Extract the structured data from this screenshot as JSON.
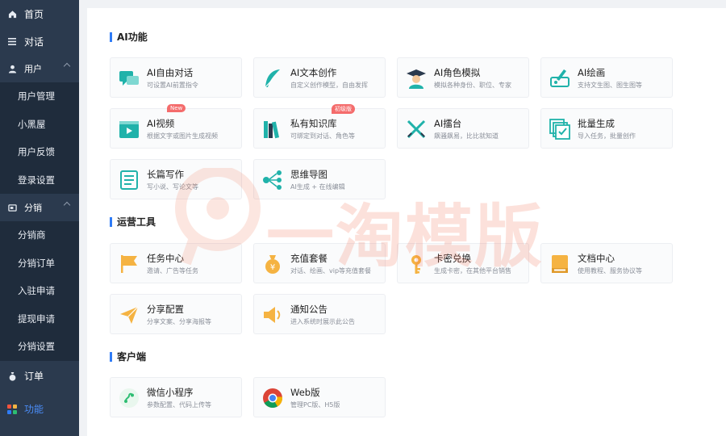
{
  "sidebar": {
    "home": "首页",
    "chat": "对话",
    "groups": [
      {
        "label": "用户",
        "items": [
          "用户管理",
          "小黑屋",
          "用户反馈",
          "登录设置"
        ]
      },
      {
        "label": "分销",
        "items": [
          "分销商",
          "分销订单",
          "入驻申请",
          "提现申请",
          "分销设置"
        ]
      }
    ],
    "order": "订单",
    "features": "功能"
  },
  "sections": {
    "ai": "AI功能",
    "ops": "运营工具",
    "client": "客户端"
  },
  "ai_cards": [
    {
      "title": "AI自由对话",
      "desc": "可设置AI前置指令"
    },
    {
      "title": "AI文本创作",
      "desc": "自定义创作模型，自由发挥"
    },
    {
      "title": "AI角色模拟",
      "desc": "模拟各种身份、职位、专家"
    },
    {
      "title": "AI绘画",
      "desc": "支持文生图、图生图等"
    },
    {
      "title": "AI视频",
      "desc": "根据文字或图片生成视频",
      "tag": "New"
    },
    {
      "title": "私有知识库",
      "desc": "可绑定到对话、角色等",
      "tag": "初级版"
    },
    {
      "title": "AI擂台",
      "desc": "飙骚飙易，比比就知道"
    },
    {
      "title": "批量生成",
      "desc": "导入任务，批量创作"
    },
    {
      "title": "长篇写作",
      "desc": "写小说、写论文等"
    },
    {
      "title": "思维导图",
      "desc": "AI生成 + 在线编辑"
    }
  ],
  "ops_cards": [
    {
      "title": "任务中心",
      "desc": "邀请、广告等任务"
    },
    {
      "title": "充值套餐",
      "desc": "对话、绘画、vip等充值套餐"
    },
    {
      "title": "卡密兑换",
      "desc": "生成卡密，在其他平台销售"
    },
    {
      "title": "文档中心",
      "desc": "使用教程、服务协议等"
    },
    {
      "title": "分享配置",
      "desc": "分享文案、分享海报等"
    },
    {
      "title": "通知公告",
      "desc": "进入系统时展示此公告"
    }
  ],
  "client_cards": [
    {
      "title": "微信小程序",
      "desc": "参数配置、代码上传等"
    },
    {
      "title": "Web版",
      "desc": "管理PC版、H5版"
    }
  ],
  "watermark": "一淘模版",
  "colors": {
    "sidebar_bg": "#2b3a4e",
    "submenu_bg": "#1f2c3c",
    "accent": "#2f7cf6",
    "icon_teal": "#20b2aa",
    "icon_orange": "#f5b342"
  }
}
